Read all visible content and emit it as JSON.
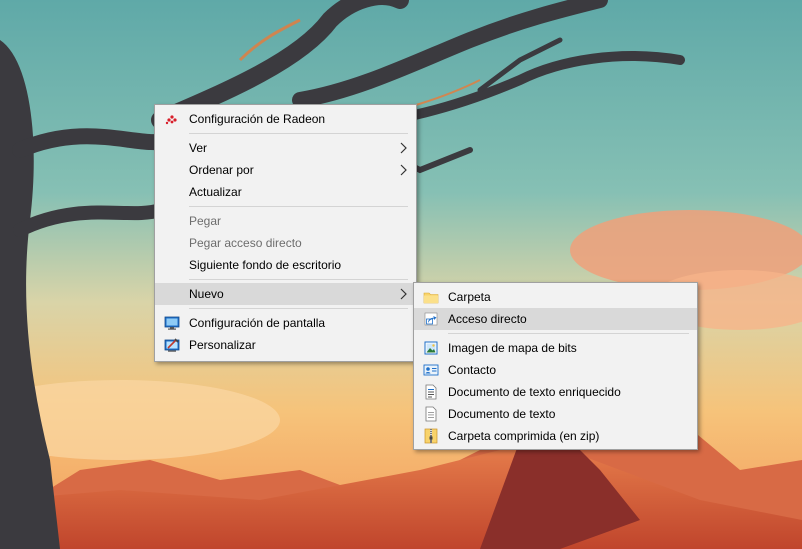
{
  "main_menu": {
    "items": [
      {
        "label": "Configuración de Radeon",
        "icon": "radeon-icon"
      },
      {
        "label": "Ver",
        "submenu": true
      },
      {
        "label": "Ordenar por",
        "submenu": true
      },
      {
        "label": "Actualizar"
      },
      {
        "label": "Pegar",
        "disabled": true
      },
      {
        "label": "Pegar acceso directo",
        "disabled": true
      },
      {
        "label": "Siguiente fondo de escritorio"
      },
      {
        "label": "Nuevo",
        "submenu": true,
        "highlighted": true
      },
      {
        "label": "Configuración de pantalla",
        "icon": "display-settings-icon"
      },
      {
        "label": "Personalizar",
        "icon": "personalize-icon"
      }
    ]
  },
  "sub_menu": {
    "items": [
      {
        "label": "Carpeta",
        "icon": "folder-icon"
      },
      {
        "label": "Acceso directo",
        "icon": "shortcut-icon",
        "highlighted": true
      },
      {
        "label": "Imagen de mapa de bits",
        "icon": "bitmap-icon"
      },
      {
        "label": "Contacto",
        "icon": "contact-icon"
      },
      {
        "label": "Documento de texto enriquecido",
        "icon": "rich-text-document-icon"
      },
      {
        "label": "Documento de texto",
        "icon": "text-document-icon"
      },
      {
        "label": "Carpeta comprimida (en zip)",
        "icon": "zip-folder-icon"
      }
    ]
  },
  "colors": {
    "menu_background": "#f2f2f2",
    "menu_border": "#a0a0a0",
    "highlight": "#d9d9d9",
    "disabled_text": "#6d6d6d",
    "sky": "#6fb5b0",
    "sunset": "#f6c37a"
  }
}
